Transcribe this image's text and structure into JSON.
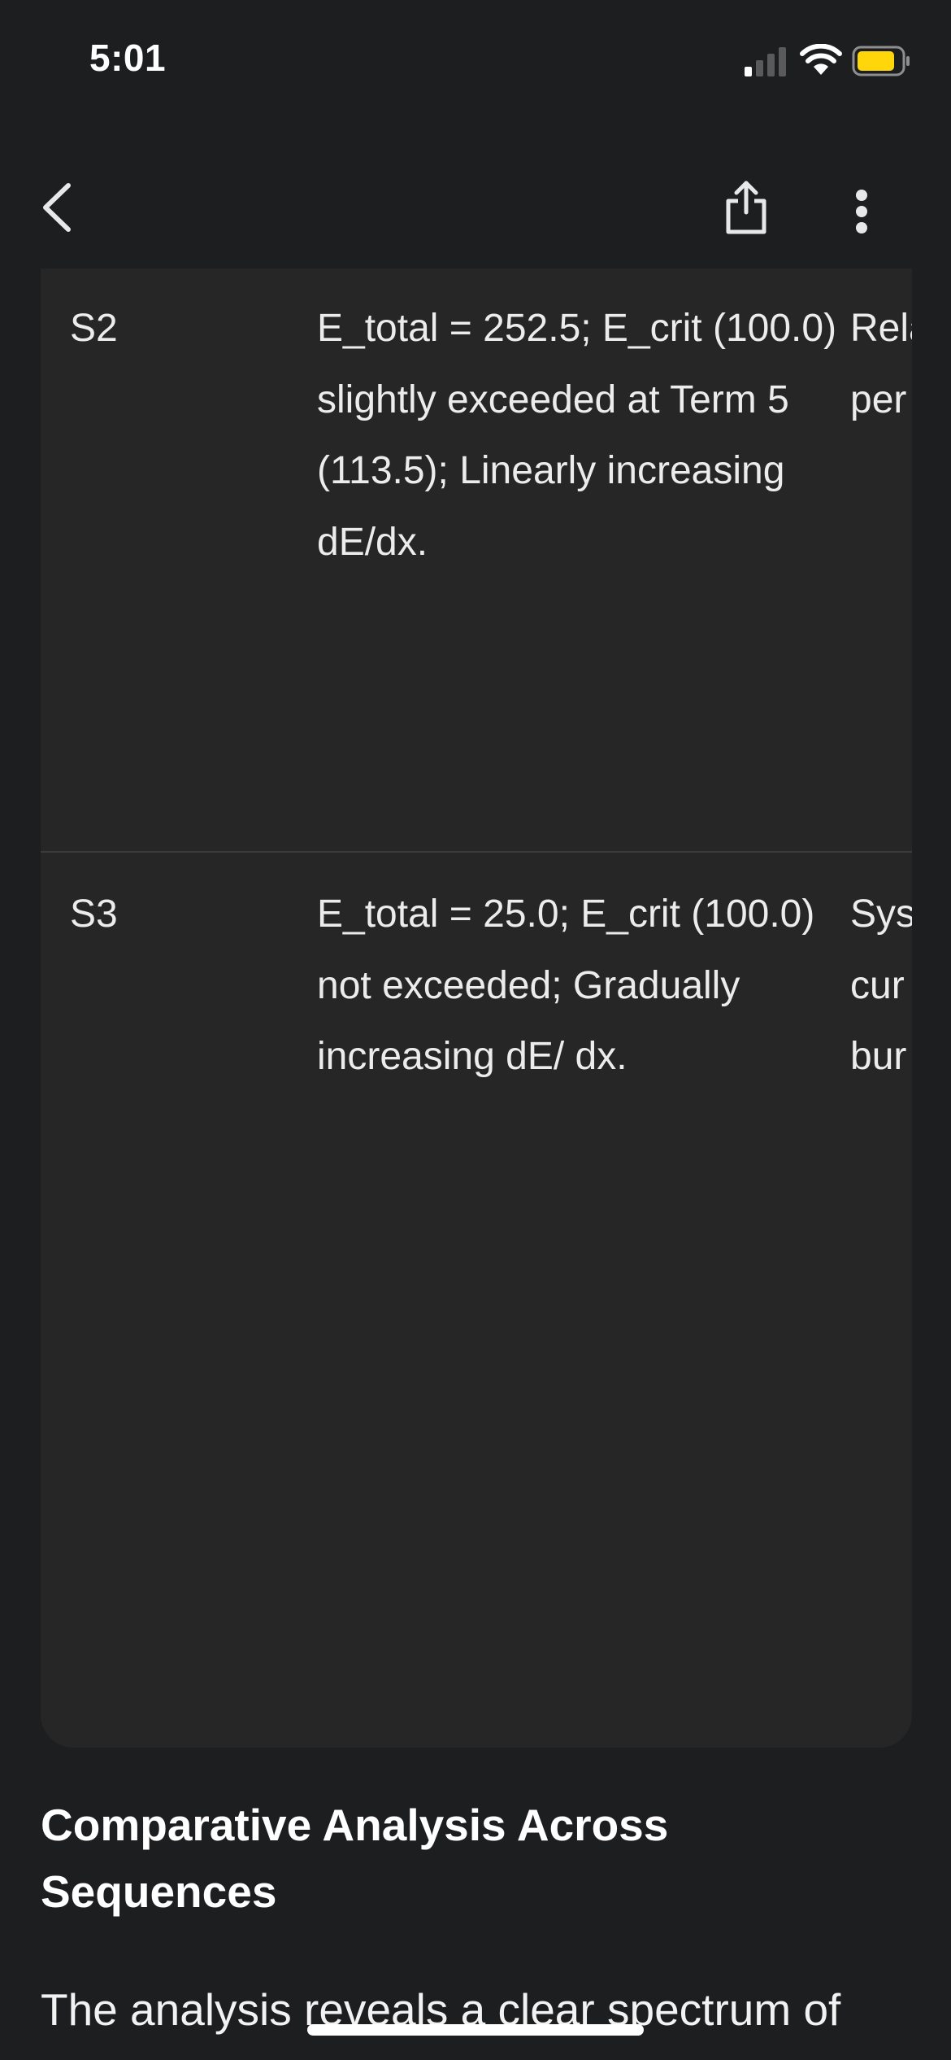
{
  "status_bar": {
    "time": "5:01",
    "battery_color": "#ffd60a"
  },
  "nav": {
    "icons": [
      "chevron-left-icon",
      "share-icon",
      "more-vertical-icon"
    ]
  },
  "table": {
    "rows": [
      {
        "id": "S2",
        "metrics": "E_total = 252.5; E_crit (100.0) slightly exceeded at Term 5 (113.5); Linearly increasing dE/dx.",
        "interpretation": "Rela resi con acc sus per of lo man"
      },
      {
        "id": "S3",
        "metrics": "E_total = 25.0; E_crit (100.0) not exceeded; Gradually increasing dE/ dx.",
        "interpretation": "Sys con pro pot in e cur ene con unio stal bur em"
      }
    ]
  },
  "section": {
    "heading": "Comparative Analysis Across Sequences",
    "body": "The analysis reveals a clear spectrum of"
  }
}
